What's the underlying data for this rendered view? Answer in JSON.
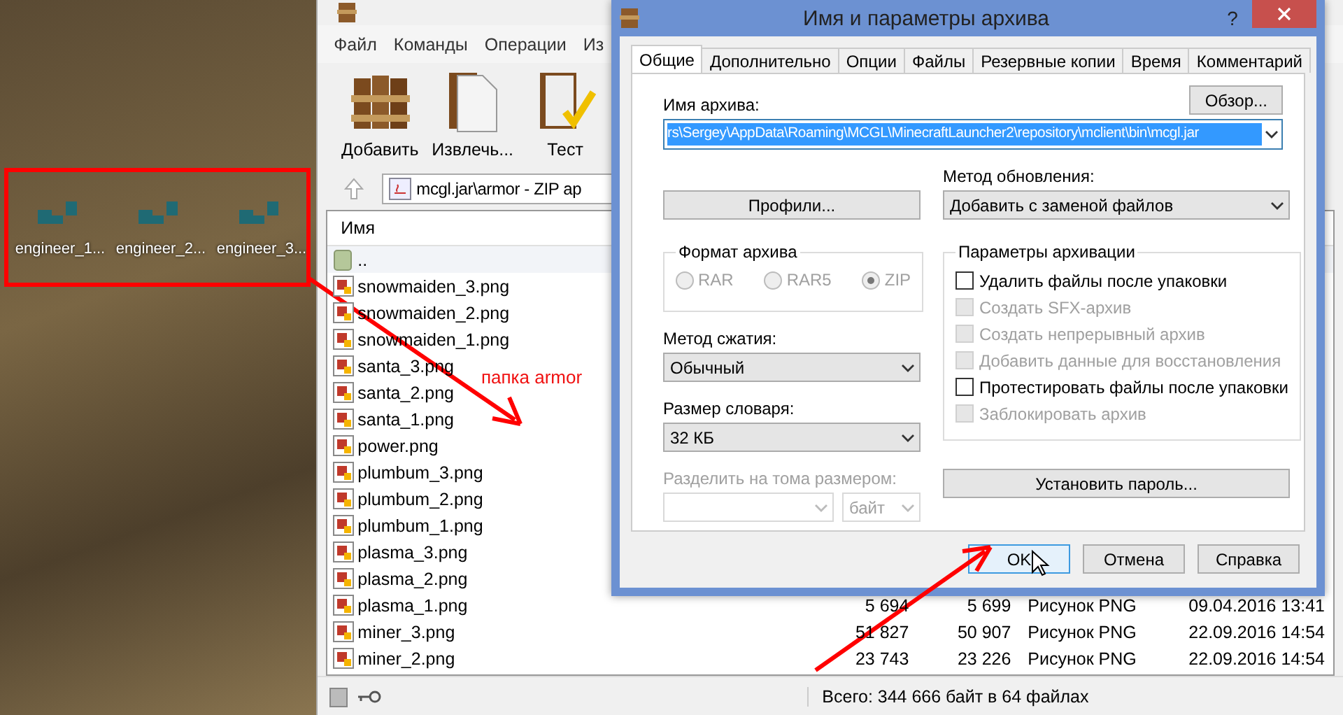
{
  "desktop": {
    "icons": [
      {
        "label": "engineer_1..."
      },
      {
        "label": "engineer_2..."
      },
      {
        "label": "engineer_3..."
      }
    ]
  },
  "main_window": {
    "menu": [
      "Файл",
      "Команды",
      "Операции",
      "Из"
    ],
    "toolbar": [
      {
        "label": "Добавить",
        "kind": "add"
      },
      {
        "label": "Извлечь...",
        "kind": "extract"
      },
      {
        "label": "Тест",
        "kind": "test"
      }
    ],
    "address": "mcgl.jar\\armor - ZIP ap",
    "columns": [
      "Имя"
    ],
    "rows": [
      {
        "name": "..",
        "kind": "up"
      },
      {
        "name": "snowmaiden_3.png",
        "kind": "file"
      },
      {
        "name": "snowmaiden_2.png",
        "kind": "file"
      },
      {
        "name": "snowmaiden_1.png",
        "kind": "file"
      },
      {
        "name": "santa_3.png",
        "kind": "file"
      },
      {
        "name": "santa_2.png",
        "kind": "file"
      },
      {
        "name": "santa_1.png",
        "kind": "file"
      },
      {
        "name": "power.png",
        "kind": "file"
      },
      {
        "name": "plumbum_3.png",
        "kind": "file"
      },
      {
        "name": "plumbum_2.png",
        "kind": "file"
      },
      {
        "name": "plumbum_1.png",
        "kind": "file"
      },
      {
        "name": "plasma_3.png",
        "kind": "file"
      },
      {
        "name": "plasma_2.png",
        "kind": "file"
      },
      {
        "name": "plasma_1.png",
        "kind": "file",
        "size": "5 694",
        "packed": "5 699",
        "type": "Рисунок PNG",
        "modified": "09.04.2016 13:41"
      },
      {
        "name": "miner_3.png",
        "kind": "file",
        "size": "51 827",
        "packed": "50 907",
        "type": "Рисунок PNG",
        "modified": "22.09.2016 14:54"
      },
      {
        "name": "miner_2.png",
        "kind": "file",
        "size": "23 743",
        "packed": "23 226",
        "type": "Рисунок PNG",
        "modified": "22.09.2016 14:54"
      }
    ],
    "status": "Всего: 344 666 байт в 64 файлах"
  },
  "dialog": {
    "title": "Имя и параметры архива",
    "help": "?",
    "tabs": [
      {
        "label": "Общие",
        "selected": true
      },
      {
        "label": "Дополнительно",
        "selected": false
      },
      {
        "label": "Опции",
        "selected": false
      },
      {
        "label": "Файлы",
        "selected": false
      },
      {
        "label": "Резервные копии",
        "selected": false
      },
      {
        "label": "Время",
        "selected": false
      },
      {
        "label": "Комментарий",
        "selected": false
      }
    ],
    "archive_name": {
      "label": "Имя архива:",
      "value": "rs\\Sergey\\AppData\\Roaming\\MCGL\\MinecraftLauncher2\\repository\\mclient\\bin\\mcgl.jar",
      "browse": "Обзор..."
    },
    "profiles": "Профили...",
    "update_method": {
      "label": "Метод обновления:",
      "value": "Добавить с заменой файлов"
    },
    "format": {
      "title": "Формат архива",
      "options": [
        {
          "label": "RAR",
          "selected": false,
          "disabled": true
        },
        {
          "label": "RAR5",
          "selected": false,
          "disabled": true
        },
        {
          "label": "ZIP",
          "selected": true,
          "disabled": true
        }
      ]
    },
    "compression": {
      "label": "Метод сжатия:",
      "value": "Обычный"
    },
    "dictionary": {
      "label": "Размер словаря:",
      "value": "32 КБ"
    },
    "split": {
      "label": "Разделить на тома размером:",
      "unit": "байт",
      "disabled": true
    },
    "options": {
      "title": "Параметры архивации",
      "items": [
        {
          "label": "Удалить файлы после упаковки",
          "checked": false,
          "disabled": false
        },
        {
          "label": "Создать SFX-архив",
          "checked": false,
          "disabled": true
        },
        {
          "label": "Создать непрерывный архив",
          "checked": false,
          "disabled": true
        },
        {
          "label": "Добавить данные для восстановления",
          "checked": false,
          "disabled": true
        },
        {
          "label": "Протестировать файлы после упаковки",
          "checked": false,
          "disabled": false
        },
        {
          "label": "Заблокировать архив",
          "checked": false,
          "disabled": true
        }
      ]
    },
    "password": "Установить пароль...",
    "buttons": [
      {
        "label": "OK",
        "selected": true
      },
      {
        "label": "Отмена",
        "selected": false
      },
      {
        "label": "Справка",
        "selected": false
      }
    ]
  },
  "annotations": {
    "label": "папка armor"
  }
}
